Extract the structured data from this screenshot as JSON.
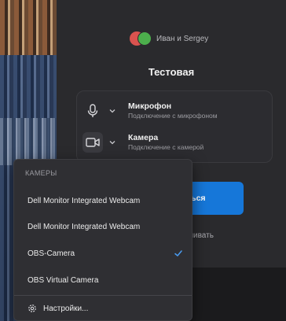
{
  "header": {
    "participants": "Иван и Sergey",
    "title": "Тестовая"
  },
  "devices": {
    "microphone": {
      "name": "Микрофон",
      "status": "Подключение с микрофоном"
    },
    "camera": {
      "name": "Камера",
      "status": "Подключение с камерой"
    }
  },
  "join_button_label": "ться",
  "extra_option_label": "шивать",
  "camera_menu": {
    "header": "КАМЕРЫ",
    "items": [
      {
        "label": "Dell Monitor Integrated Webcam",
        "selected": false
      },
      {
        "label": "Dell Monitor Integrated Webcam",
        "selected": false
      },
      {
        "label": "OBS-Camera",
        "selected": true
      },
      {
        "label": "OBS Virtual Camera",
        "selected": false
      }
    ],
    "settings_label": "Настройки..."
  },
  "colors": {
    "accent": "#1677d9",
    "panel": "#2a2a2d",
    "menu": "#2f2f33"
  }
}
